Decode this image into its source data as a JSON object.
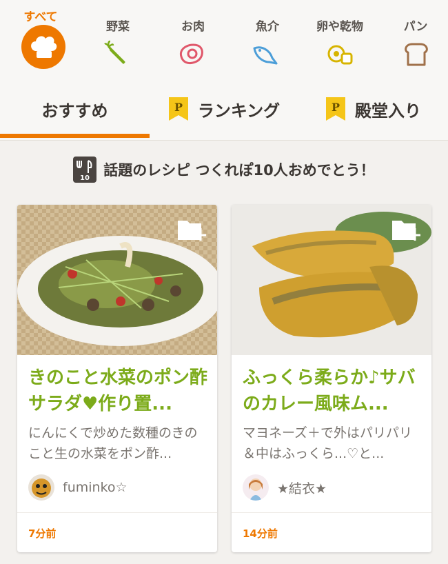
{
  "categories": [
    {
      "label": "すべて",
      "icon": "chef-hat-icon",
      "selected": true
    },
    {
      "label": "野菜",
      "icon": "carrot-icon"
    },
    {
      "label": "お肉",
      "icon": "meat-icon"
    },
    {
      "label": "魚介",
      "icon": "fish-icon"
    },
    {
      "label": "卵や乾物",
      "icon": "egg-icon"
    },
    {
      "label": "パン",
      "icon": "bread-icon"
    }
  ],
  "tabs": [
    {
      "label": "おすすめ",
      "selected": true
    },
    {
      "label": "ランキング",
      "badge": "P"
    },
    {
      "label": "殿堂入り",
      "badge": "P"
    }
  ],
  "banner": {
    "icon_number": "10",
    "text": "話題のレシピ つくれぽ10人おめでとう！"
  },
  "cards": [
    {
      "title": "きのこと水菜のポン酢サラダ♥作り置...",
      "description": "にんにくで炒めた数種のきのこと生の水菜をポン酢...",
      "user": "fuminko☆",
      "time": "7分前"
    },
    {
      "title": "ふっくら柔らか♪サバのカレー風味ム...",
      "description": "マヨネーズ＋で外はパリパリ＆中はふっくら...♡と...",
      "user": "★結衣★",
      "time": "14分前"
    }
  ],
  "colors": {
    "accent": "#ee7800",
    "title_green": "#7cab1a",
    "badge_yellow": "#f5c518"
  }
}
